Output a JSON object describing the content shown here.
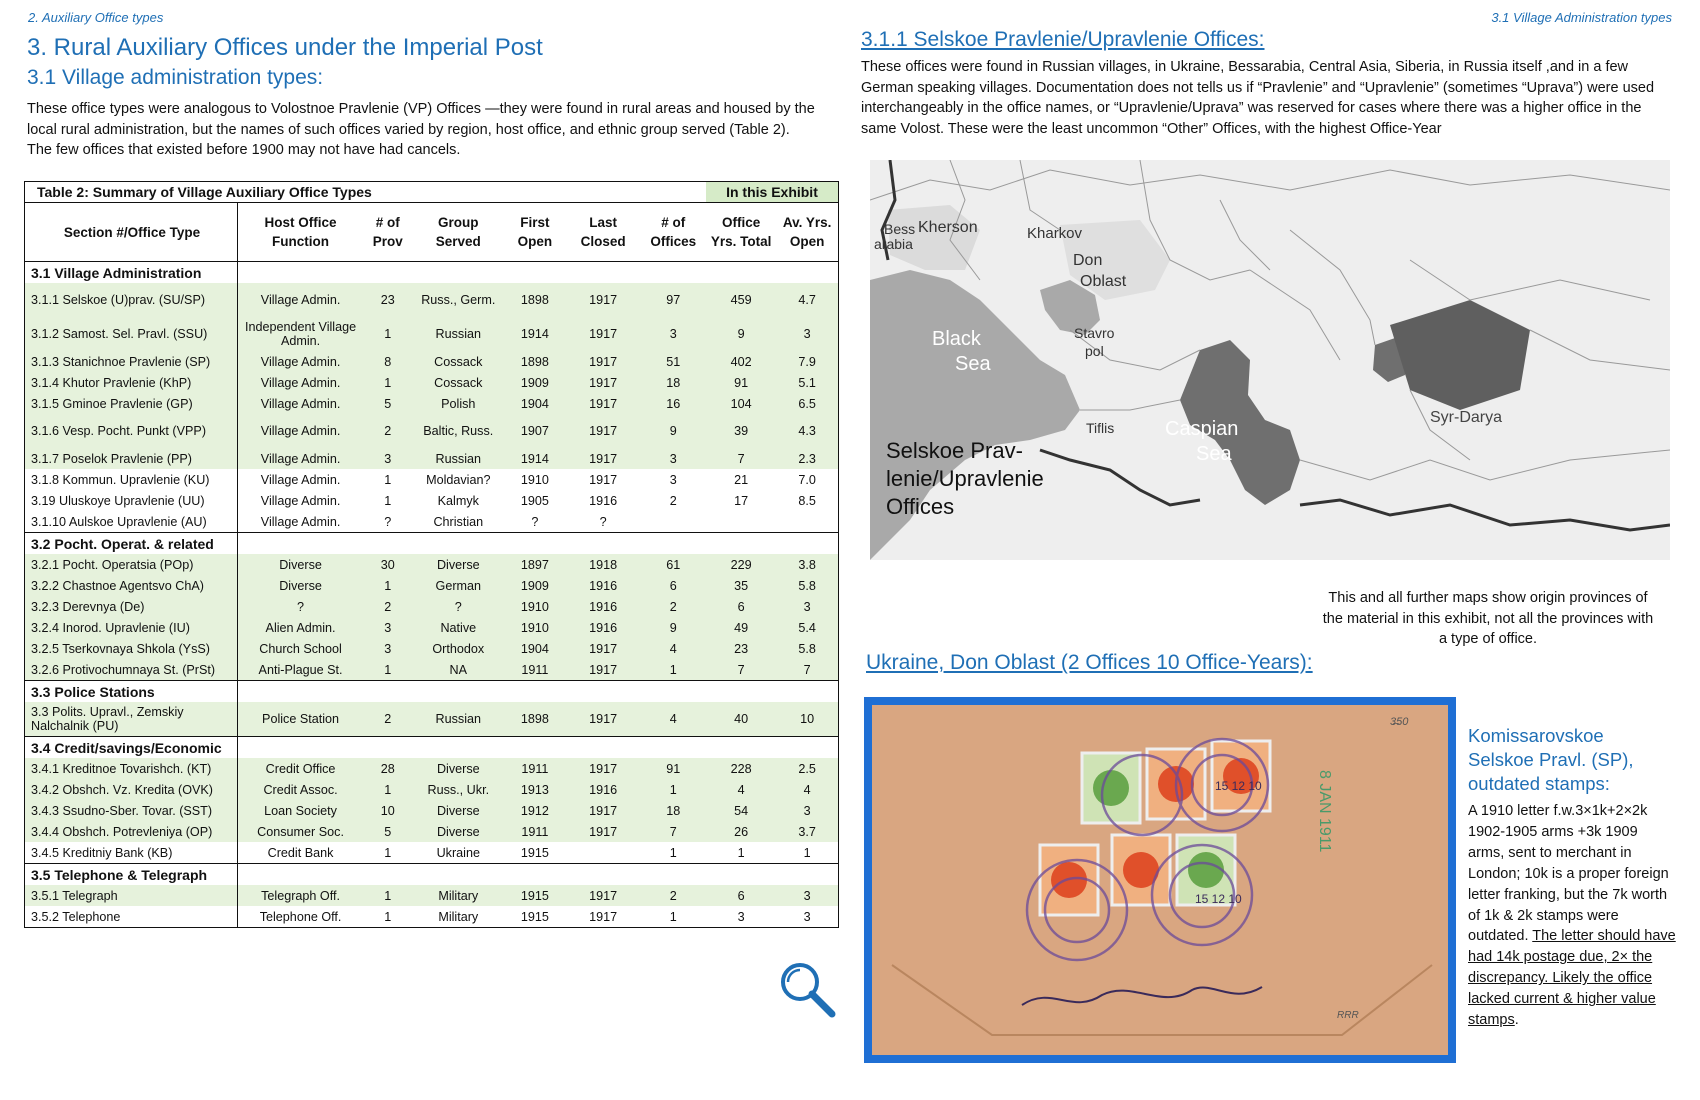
{
  "header": {
    "left": "2. Auxiliary Office types",
    "right": "3.1 Village Administration types"
  },
  "left_page": {
    "title": "3. Rural Auxiliary Offices under the Imperial Post",
    "subtitle": "3.1 Village administration types:",
    "intro": "These office types were analogous to Volostnoe Pravlenie (VP) Offices —they were found in rural areas and housed by the local rural administration, but the names of such offices varied by region, host office, and ethnic group served (Table 2). The few offices that existed before 1900 may not have had cancels."
  },
  "table": {
    "title": "Table 2: Summary of Village Auxiliary Office Types",
    "exhibit_label": "In this Exhibit",
    "headers": [
      "Section #/Office Type",
      "Host Office Function",
      "# of Prov",
      "Group Served",
      "First Open",
      "Last Closed",
      "# of Offices",
      "Office Yrs. Total",
      "Av. Yrs. Open"
    ],
    "sections": [
      {
        "name": "3.1 Village Administration",
        "rows": [
          {
            "type": "3.1.1 Selskoe (U)prav. (SU/SP)",
            "host": "Village Admin.",
            "prov": "23",
            "group": "Russ., Germ.",
            "first": "1898",
            "last": "1917",
            "offices": "97",
            "yrs": "459",
            "avg": "4.7",
            "tall": true,
            "shade": "g"
          },
          {
            "type": "3.1.2 Samost. Sel. Pravl. (SSU)",
            "host": "Independent Village Admin.",
            "prov": "1",
            "group": "Russian",
            "first": "1914",
            "last": "1917",
            "offices": "3",
            "yrs": "9",
            "avg": "3",
            "tall": true,
            "shade": "g"
          },
          {
            "type": "3.1.3 Stanichnoe Pravlenie (SP)",
            "host": "Village Admin.",
            "prov": "8",
            "group": "Cossack",
            "first": "1898",
            "last": "1917",
            "offices": "51",
            "yrs": "402",
            "avg": "7.9",
            "tall": false,
            "shade": "g"
          },
          {
            "type": "3.1.4 Khutor Pravlenie (KhP)",
            "host": "Village Admin.",
            "prov": "1",
            "group": "Cossack",
            "first": "1909",
            "last": "1917",
            "offices": "18",
            "yrs": "91",
            "avg": "5.1",
            "tall": false,
            "shade": "g"
          },
          {
            "type": "3.1.5 Gminoe Pravlenie (GP)",
            "host": "Village Admin.",
            "prov": "5",
            "group": "Polish",
            "first": "1904",
            "last": "1917",
            "offices": "16",
            "yrs": "104",
            "avg": "6.5",
            "tall": false,
            "shade": "g"
          },
          {
            "type": "3.1.6 Vesp. Pocht. Punkt (VPP)",
            "host": "Village Admin.",
            "prov": "2",
            "group": "Baltic, Russ.",
            "first": "1907",
            "last": "1917",
            "offices": "9",
            "yrs": "39",
            "avg": "4.3",
            "tall": true,
            "shade": "g"
          },
          {
            "type": "3.1.7 Poselok Pravlenie (PP)",
            "host": "Village Admin.",
            "prov": "3",
            "group": "Russian",
            "first": "1914",
            "last": "1917",
            "offices": "3",
            "yrs": "7",
            "avg": "2.3",
            "tall": false,
            "shade": "g"
          },
          {
            "type": "3.1.8 Kommun. Upravlenie (KU)",
            "host": "Village Admin.",
            "prov": "1",
            "group": "Moldavian?",
            "first": "1910",
            "last": "1917",
            "offices": "3",
            "yrs": "21",
            "avg": "7.0",
            "tall": false,
            "shade": "w"
          },
          {
            "type": "3.19 Uluskoye Upravlenie (UU)",
            "host": "Village Admin.",
            "prov": "1",
            "group": "Kalmyk",
            "first": "1905",
            "last": "1916",
            "offices": "2",
            "yrs": "17",
            "avg": "8.5",
            "tall": false,
            "shade": "w"
          },
          {
            "type": "3.1.10 Aulskoe Upravlenie (AU)",
            "host": "Village Admin.",
            "prov": "?",
            "group": "Christian",
            "first": "?",
            "last": "?",
            "offices": "",
            "yrs": "",
            "avg": "",
            "tall": false,
            "shade": "w"
          }
        ]
      },
      {
        "name": "3.2 Pocht. Operat. & related",
        "rows": [
          {
            "type": "3.2.1 Pocht. Operatsia (POp)",
            "host": "Diverse",
            "prov": "30",
            "group": "Diverse",
            "first": "1897",
            "last": "1918",
            "offices": "61",
            "yrs": "229",
            "avg": "3.8",
            "tall": false,
            "shade": "g"
          },
          {
            "type": "3.2.2 Chastnoe Agentsvo ChA)",
            "host": "Diverse",
            "prov": "1",
            "group": "German",
            "first": "1909",
            "last": "1916",
            "offices": "6",
            "yrs": "35",
            "avg": "5.8",
            "tall": false,
            "shade": "g"
          },
          {
            "type": "3.2.3 Derevnya (De)",
            "host": "?",
            "prov": "2",
            "group": "?",
            "first": "1910",
            "last": "1916",
            "offices": "2",
            "yrs": "6",
            "avg": "3",
            "tall": false,
            "shade": "g"
          },
          {
            "type": "3.2.4 Inorod. Upravlenie (IU)",
            "host": "Alien Admin.",
            "prov": "3",
            "group": "Native",
            "first": "1910",
            "last": "1916",
            "offices": "9",
            "yrs": "49",
            "avg": "5.4",
            "tall": false,
            "shade": "g"
          },
          {
            "type": "3.2.5 Tserkovnaya Shkola (YsS)",
            "host": "Church School",
            "prov": "3",
            "group": "Orthodox",
            "first": "1904",
            "last": "1917",
            "offices": "4",
            "yrs": "23",
            "avg": "5.8",
            "tall": false,
            "shade": "g"
          },
          {
            "type": "3.2.6 Protivochumnaya St. (PrSt)",
            "host": "Anti-Plague St.",
            "prov": "1",
            "group": "NA",
            "first": "1911",
            "last": "1917",
            "offices": "1",
            "yrs": "7",
            "avg": "7",
            "tall": false,
            "shade": "g"
          }
        ]
      },
      {
        "name": "3.3 Police Stations",
        "rows": [
          {
            "type": "3.3 Polits. Upravl., Zemskiy Nalchalnik (PU)",
            "host": "Police Station",
            "prov": "2",
            "group": "Russian",
            "first": "1898",
            "last": "1917",
            "offices": "4",
            "yrs": "40",
            "avg": "10",
            "tall": true,
            "shade": "g"
          }
        ]
      },
      {
        "name": "3.4 Credit/savings/Economic",
        "rows": [
          {
            "type": "3.4.1 Kreditnoe Tovarishch. (KT)",
            "host": "Credit Office",
            "prov": "28",
            "group": "Diverse",
            "first": "1911",
            "last": "1917",
            "offices": "91",
            "yrs": "228",
            "avg": "2.5",
            "tall": false,
            "shade": "g"
          },
          {
            "type": "3.4.2 Obshch. Vz. Kredita (OVK)",
            "host": "Credit Assoc.",
            "prov": "1",
            "group": "Russ., Ukr.",
            "first": "1913",
            "last": "1916",
            "offices": "1",
            "yrs": "4",
            "avg": "4",
            "tall": false,
            "shade": "g"
          },
          {
            "type": "3.4.3 Ssudno-Sber. Tovar. (SST)",
            "host": "Loan Society",
            "prov": "10",
            "group": "Diverse",
            "first": "1912",
            "last": "1917",
            "offices": "18",
            "yrs": "54",
            "avg": "3",
            "tall": false,
            "shade": "g"
          },
          {
            "type": "3.4.4 Obshch. Potrevleniya (OP)",
            "host": "Consumer Soc.",
            "prov": "5",
            "group": "Diverse",
            "first": "1911",
            "last": "1917",
            "offices": "7",
            "yrs": "26",
            "avg": "3.7",
            "tall": false,
            "shade": "g"
          },
          {
            "type": "3.4.5 Kreditniy Bank (KB)",
            "host": "Credit Bank",
            "prov": "1",
            "group": "Ukraine",
            "first": "1915",
            "last": "",
            "offices": "1",
            "yrs": "1",
            "avg": "1",
            "tall": false,
            "shade": "w"
          }
        ]
      },
      {
        "name": "3.5 Telephone & Telegraph",
        "rows": [
          {
            "type": "3.5.1 Telegraph",
            "host": "Telegraph Off.",
            "prov": "1",
            "group": "Military",
            "first": "1915",
            "last": "1917",
            "offices": "2",
            "yrs": "6",
            "avg": "3",
            "tall": false,
            "shade": "g"
          },
          {
            "type": "3.5.2 Telephone",
            "host": "Telephone Off.",
            "prov": "1",
            "group": "Military",
            "first": "1915",
            "last": "1917",
            "offices": "1",
            "yrs": "3",
            "avg": "3",
            "tall": false,
            "shade": "w"
          }
        ]
      }
    ]
  },
  "right_page": {
    "heading": "3.1.1 Selskoe Pravlenie/Upravlenie Offices:",
    "intro": "These offices were found in Russian villages, in Ukraine, Bessarabia, Central Asia, Siberia, in Russia itself ,and in a few German speaking villages. Documentation does not tells us if “Pravlenie” and “Upravlenie” (sometimes “Uprava”) were used interchangeably  in the office names, or “Upravlenie/Uprava” was reserved for cases where there was a higher office in the same Volost. These were the least uncommon “Other” Offices, with the highest Office-Year",
    "map": {
      "caption_lines": [
        "Selskoe Prav-",
        "lenie/Upravlenie",
        "Offices"
      ],
      "labels": {
        "bess": "Bess",
        "arabia": "arabia",
        "kherson": "Kherson",
        "kharkov": "Kharkov",
        "don": "Don",
        "oblast": "Oblast",
        "black": "Black",
        "sea": "Sea",
        "stavro": "Stavro",
        "pol": "pol",
        "tiflis": "Tiflis",
        "caspian": "Caspian",
        "caspian_sea": "Sea",
        "syr_darya": "Syr-Darya"
      }
    },
    "map_note": "This and all further maps show origin provinces of the material in this exhibit, not all the provinces with a type of office.",
    "section_heading": "Ukraine, Don Oblast (2 Offices 10 Office-Years):",
    "cover_marks": {
      "pencil_top": "3̶50",
      "vertical_stamp": "8 JAN 1911",
      "stamp_date_1": "15 12 10",
      "stamp_date_2": "15 12 10",
      "pencil_bottom": "RRR"
    },
    "caption_heading": "Komissarovskoe Selskoe Pravl. (SP), outdated stamps:",
    "caption_plain": "A 1910 letter f.w.3×1k+2×2k 1902-1905 arms +3k 1909 arms, sent to merchant in London; 10k is a proper foreign letter franking, but the 7k worth of 1k & 2k stamps were outdated. ",
    "caption_underlined": "The letter should have had 14k postage due, 2× the discrepancy. Likely the office lacked current & higher value stamps",
    "caption_end": "."
  },
  "colors": {
    "accent": "#1f6fb5",
    "table_green": "#e6f2dc",
    "cover_border": "#1f6fd4"
  }
}
